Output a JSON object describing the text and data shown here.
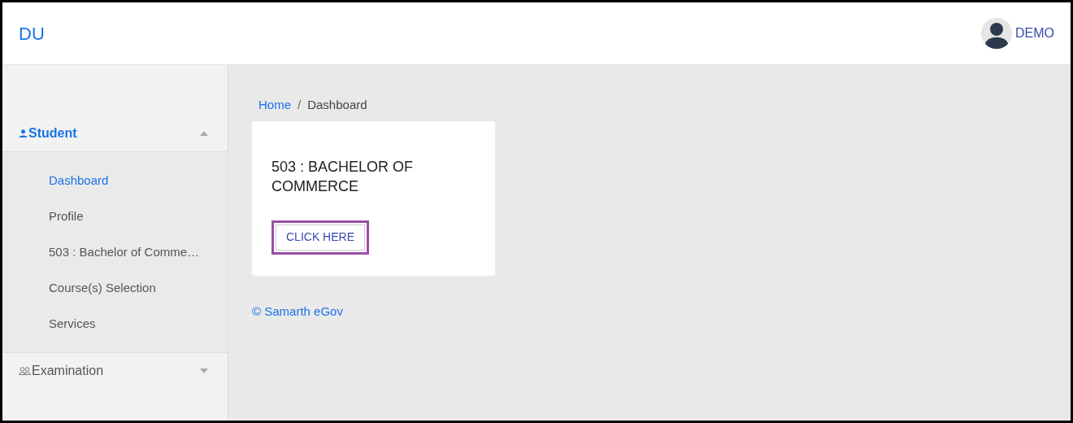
{
  "header": {
    "brand": "DU",
    "user": "DEMO"
  },
  "sidebar": {
    "sections": [
      {
        "label": "Student",
        "kind": "person",
        "expanded": true,
        "selected": true,
        "items": [
          {
            "label": "Dashboard",
            "selected": true
          },
          {
            "label": "Profile",
            "selected": false
          },
          {
            "label": "503 : Bachelor of Comme…",
            "selected": false
          },
          {
            "label": "Course(s) Selection",
            "selected": false
          },
          {
            "label": "Services",
            "selected": false
          }
        ]
      },
      {
        "label": "Examination",
        "kind": "people",
        "expanded": false,
        "selected": false
      }
    ]
  },
  "breadcrumb": [
    {
      "label": "Home",
      "kind": "link"
    },
    {
      "label": "Dashboard",
      "kind": "current"
    }
  ],
  "breadcrumb_separator": "/",
  "card": {
    "title": "503 : BACHELOR OF COMMERCE",
    "button": "CLICK HERE",
    "highlighted": true
  },
  "footer": "© Samarth eGov"
}
